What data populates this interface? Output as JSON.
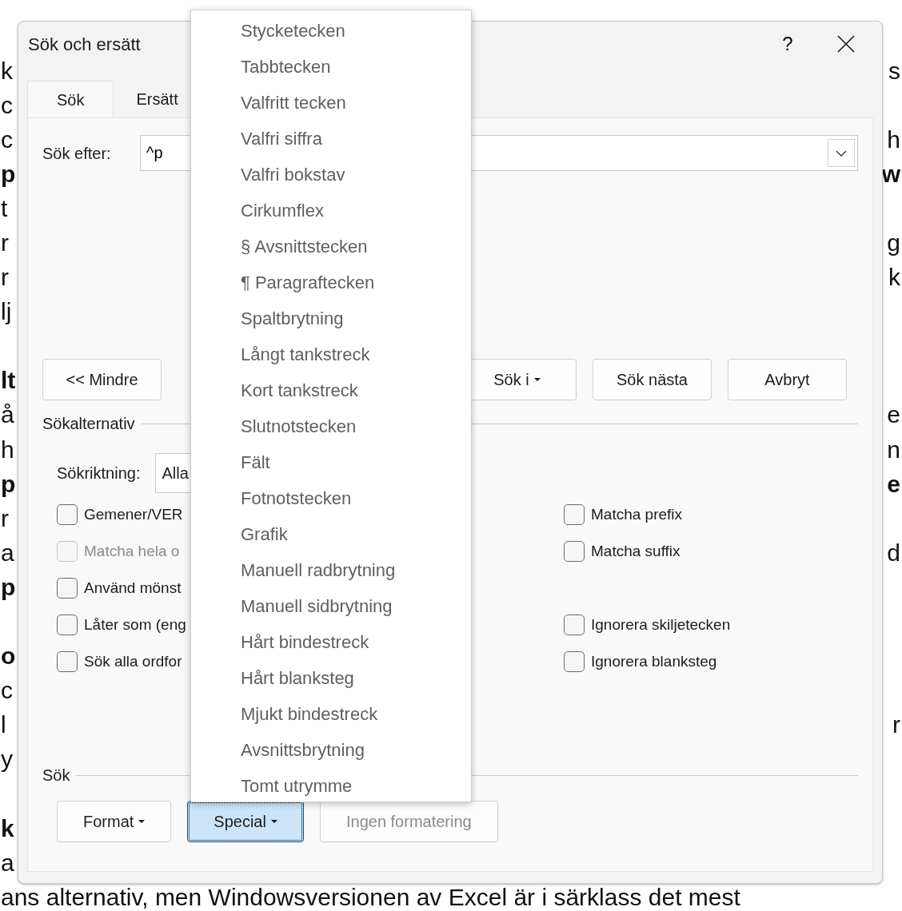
{
  "document": {
    "paragraphs": [
      [
        {
          "left": "k",
          "right": "s"
        },
        {
          "left": "c"
        },
        {
          "left": "c",
          "right": "h"
        },
        {
          "left": "p",
          "right": "w",
          "bold": true
        },
        {
          "left": "t"
        },
        {
          "left": "r",
          "right": "g"
        },
        {
          "left": "r",
          "right": "k"
        },
        {
          "left": "lj"
        }
      ],
      [
        {
          "left": "lt",
          "bold": true
        },
        {
          "left": "å",
          "right": "e"
        },
        {
          "left": "h",
          "right": "n"
        },
        {
          "left": "p",
          "right": "e",
          "bold": true
        },
        {
          "left": "r"
        },
        {
          "left": "a",
          "right": "d"
        },
        {
          "left": "p",
          "bold": true
        }
      ],
      [
        {
          "left": "o",
          "bold": true
        },
        {
          "left": "c"
        },
        {
          "left": "l",
          "right": "r"
        },
        {
          "left": "y"
        }
      ],
      [
        {
          "left": "k",
          "bold": true
        },
        {
          "left": "a"
        },
        {
          "left": "ans alternativ, men Windowsversionen av Excel är i särklass det mest"
        }
      ]
    ]
  },
  "dialog": {
    "title": "Sök och ersätt",
    "help": "?",
    "tabs": [
      {
        "label": "Sök",
        "selected": true
      },
      {
        "label": "Ersätt",
        "selected": false
      }
    ],
    "search": {
      "label": "Sök efter:",
      "value": "^p"
    },
    "buttons": [
      {
        "label": "<< Mindre"
      },
      {
        "label": "Sök i",
        "caret": true
      },
      {
        "label": "Sök nästa"
      },
      {
        "label": "Avbryt"
      }
    ],
    "options_heading": "Sökalternativ",
    "direction": {
      "label": "Sökriktning:",
      "value": "Alla"
    },
    "option_rows": [
      {
        "left": {
          "label": "Gemener/VER",
          "checked": false,
          "disabled": false
        },
        "right": {
          "label": "Matcha prefix",
          "checked": false,
          "disabled": false
        }
      },
      {
        "left": {
          "label": "Matcha hela o",
          "checked": false,
          "disabled": true
        },
        "right": {
          "label": "Matcha suffix",
          "checked": false,
          "disabled": false
        }
      },
      {
        "left": {
          "label": "Använd mönst",
          "checked": false,
          "disabled": false
        }
      },
      {
        "left": {
          "label": "Låter som (eng",
          "checked": false,
          "disabled": false
        },
        "right": {
          "label": "Ignorera skiljetecken",
          "checked": false,
          "disabled": false
        }
      },
      {
        "left": {
          "label": "Sök alla ordfor",
          "checked": false,
          "disabled": false
        },
        "right": {
          "label": "Ignorera blanksteg",
          "checked": false,
          "disabled": false
        }
      }
    ],
    "find_heading": "Sök",
    "bottom_buttons": [
      {
        "label": "Format",
        "caret": true,
        "pressed": false,
        "disabled": false
      },
      {
        "label": "Special",
        "caret": true,
        "pressed": true,
        "disabled": false
      },
      {
        "label": "Ingen formatering",
        "pressed": false,
        "disabled": true
      }
    ]
  },
  "special_menu": {
    "items": [
      {
        "label": "Stycketecken"
      },
      {
        "label": "Tabbtecken"
      },
      {
        "label": "Valfritt tecken"
      },
      {
        "label": "Valfri siffra"
      },
      {
        "label": "Valfri bokstav"
      },
      {
        "label": "Cirkumflex"
      },
      {
        "label": "§ Avsnittstecken"
      },
      {
        "label": "¶ Paragraftecken"
      },
      {
        "label": "Spaltbrytning"
      },
      {
        "label": "Långt tankstreck"
      },
      {
        "label": "Kort tankstreck"
      },
      {
        "label": "Slutnotstecken"
      },
      {
        "label": "Fält"
      },
      {
        "label": "Fotnotstecken"
      },
      {
        "label": "Grafik"
      },
      {
        "label": "Manuell radbrytning"
      },
      {
        "label": "Manuell sidbrytning"
      },
      {
        "label": "Hårt bindestreck"
      },
      {
        "label": "Hårt blanksteg"
      },
      {
        "label": "Mjukt bindestreck"
      },
      {
        "label": "Avsnittsbrytning"
      },
      {
        "label": "Tomt utrymme"
      }
    ]
  }
}
